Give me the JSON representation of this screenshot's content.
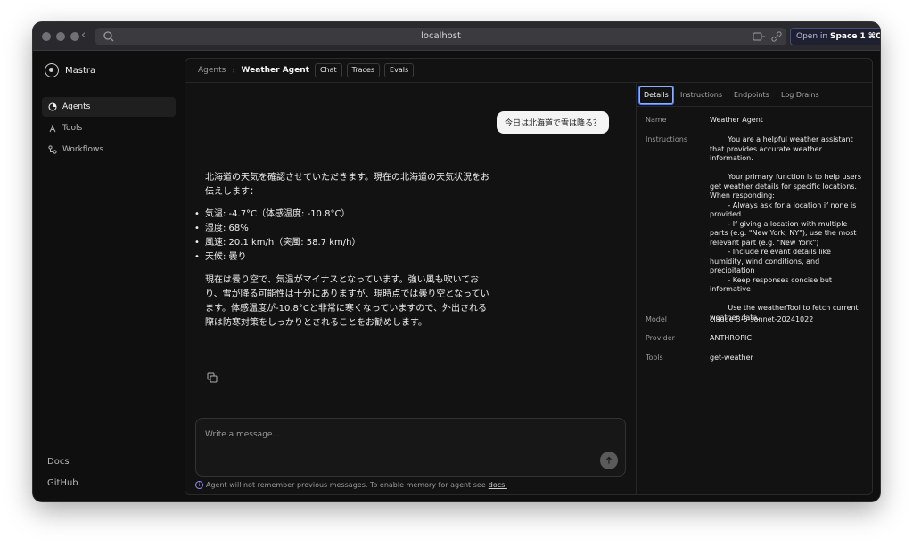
{
  "browser": {
    "url": "localhost",
    "open_in_prefix": "Open in",
    "open_in_target": "Space 1",
    "open_in_shortcut": "⌘O"
  },
  "sidebar": {
    "brand": "Mastra",
    "items": [
      {
        "label": "Agents",
        "icon": "agent-icon",
        "active": true
      },
      {
        "label": "Tools",
        "icon": "tools-icon",
        "active": false
      },
      {
        "label": "Workflows",
        "icon": "workflow-icon",
        "active": false
      }
    ],
    "docs": "Docs",
    "github": "GitHub"
  },
  "breadcrumb": {
    "root": "Agents",
    "current": "Weather Agent",
    "tabs": [
      "Chat",
      "Traces",
      "Evals"
    ]
  },
  "chat": {
    "user_message": "今日は北海道で雪は降る？",
    "reply_intro": "北海道の天気を確認させていただきます。現在の北海道の天気状況をお伝えします：",
    "reply_bullets": [
      "気温: -4.7°C（体感温度: -10.8°C）",
      "湿度: 68%",
      "風速: 20.1 km/h（突風: 58.7 km/h）",
      "天候: 曇り"
    ],
    "reply_outro": "現在は曇り空で、気温がマイナスとなっています。強い風も吹いており、雪が降る可能性は十分にありますが、現時点では曇り空となっています。体感温度が-10.8°Cと非常に寒くなっていますので、外出される際は防寒対策をしっかりとされることをお勧めします。",
    "composer_placeholder": "Write a message...",
    "memory_note": "Agent will not remember previous messages. To enable memory for agent see",
    "memory_link": "docs."
  },
  "panel": {
    "tabs": [
      "Details",
      "Instructions",
      "Endpoints",
      "Log Drains"
    ],
    "active_tab": "Details",
    "details": {
      "name_label": "Name",
      "name": "Weather Agent",
      "instructions_label": "Instructions",
      "instructions": "        You are a helpful weather assistant that provides accurate weather information.\n\n        Your primary function is to help users get weather details for specific locations. When responding:\n        - Always ask for a location if none is provided\n        - If giving a location with multiple parts (e.g. \"New York, NY\"), use the most relevant part (e.g. \"New York\")\n        - Include relevant details like humidity, wind conditions, and precipitation\n        - Keep responses concise but informative\n\n        Use the weatherTool to fetch current weather data.",
      "model_label": "Model",
      "model": "claude-3-5-sonnet-20241022",
      "provider_label": "Provider",
      "provider": "ANTHROPIC",
      "tools_label": "Tools",
      "tools": "get-weather"
    }
  },
  "colors": {
    "background": "#0f0f0f",
    "accent_focus": "#4f7fff",
    "user_bubble": "#f4f4f4"
  }
}
